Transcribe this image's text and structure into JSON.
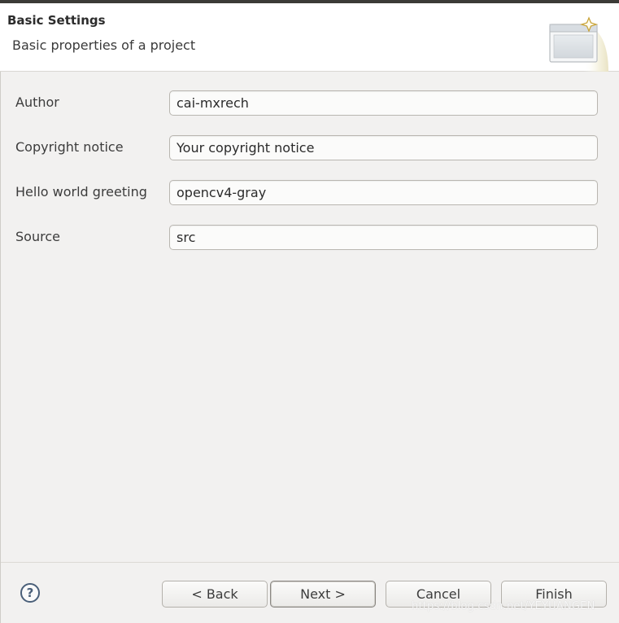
{
  "header": {
    "title": "Basic Settings",
    "description": "Basic properties of a project",
    "icon": "wizard-banner-icon"
  },
  "form": {
    "fields": [
      {
        "label": "Author",
        "value": "cai-mxrech"
      },
      {
        "label": "Copyright notice",
        "value": "Your copyright notice"
      },
      {
        "label": "Hello world greeting",
        "value": "opencv4-gray"
      },
      {
        "label": "Source",
        "value": "src"
      }
    ]
  },
  "footer": {
    "help_icon": "help-icon",
    "help_label": "?",
    "back_label": "< Back",
    "next_label": "Next >",
    "cancel_label": "Cancel",
    "finish_label": "Finish"
  },
  "watermark": "https://blog.csdn.net/YEYUANGEN"
}
